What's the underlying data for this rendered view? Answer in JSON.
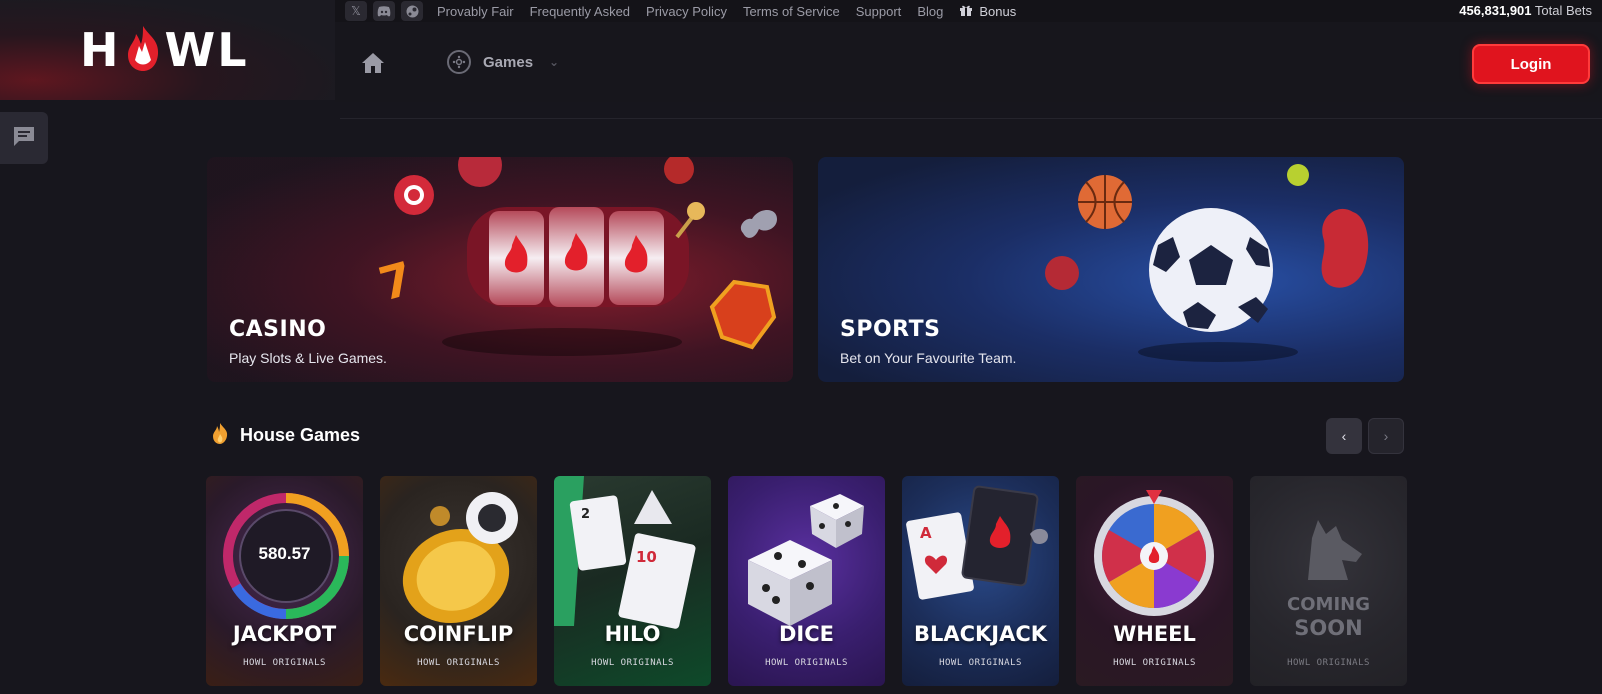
{
  "brand": {
    "logo_left": "H",
    "logo_right": "WL"
  },
  "topbar": {
    "social": [
      {
        "icon": "x-icon",
        "glyph": "𝕏"
      },
      {
        "icon": "discord-icon",
        "glyph": "◉"
      },
      {
        "icon": "steam-icon",
        "glyph": "⚙"
      }
    ],
    "links": [
      "Provably Fair",
      "Frequently Asked",
      "Privacy Policy",
      "Terms of Service",
      "Support",
      "Blog"
    ],
    "bonus_label": "Bonus",
    "total_bets_value": "456,831,901",
    "total_bets_label": "Total Bets"
  },
  "nav": {
    "games_label": "Games",
    "login_label": "Login"
  },
  "banners": {
    "casino": {
      "title": "CASINO",
      "subtitle": "Play Slots & Live Games."
    },
    "sports": {
      "title": "SPORTS",
      "subtitle": "Bet on Your Favourite Team."
    }
  },
  "house_games": {
    "title": "House Games",
    "cards": [
      {
        "title": "JACKPOT",
        "subtitle": "HOWL ORIGINALS",
        "art_value": "580.57"
      },
      {
        "title": "COINFLIP",
        "subtitle": "HOWL ORIGINALS"
      },
      {
        "title": "HILO",
        "subtitle": "HOWL ORIGINALS"
      },
      {
        "title": "DICE",
        "subtitle": "HOWL ORIGINALS"
      },
      {
        "title": "BLACKJACK",
        "subtitle": "HOWL ORIGINALS"
      },
      {
        "title": "WHEEL",
        "subtitle": "HOWL ORIGINALS"
      },
      {
        "title_line1": "COMING",
        "title_line2": "SOON",
        "subtitle": "HOWL ORIGINALS"
      }
    ]
  },
  "colors": {
    "accent": "#e0141e",
    "background": "#17161d",
    "panel": "#2a2933"
  }
}
